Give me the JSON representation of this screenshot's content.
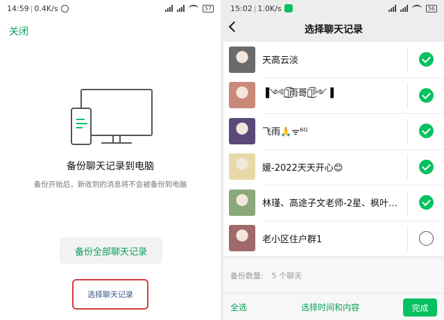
{
  "left": {
    "status": {
      "time": "14:59",
      "speed": "0.4K/s",
      "battery": "57"
    },
    "close_label": "关闭",
    "title": "备份聊天记录到电脑",
    "subtitle": "备份开始后，新收到的消息将不会被备份到电脑",
    "backup_all_label": "备份全部聊天记录",
    "select_label": "选择聊天记录"
  },
  "right": {
    "status": {
      "time": "15:02",
      "speed": "1.0K/s",
      "battery": "56"
    },
    "title": "选择聊天记录",
    "chats": [
      {
        "name": "天高云淡",
        "checked": true,
        "avatar": "#6b6b6b"
      },
      {
        "name": "▐༺ৡ͜͡雨哥ৡ͜͡༻▐",
        "checked": true,
        "avatar": "#c98a7a"
      },
      {
        "name": "飞雨🙏ᯤ⁶ᴳ",
        "checked": true,
        "avatar": "#5a4a7a"
      },
      {
        "name": "媛-2022天天开心😊",
        "checked": true,
        "avatar": "#e8d9a8"
      },
      {
        "name": "林瑾、高途子文老师-2星、枫叶…",
        "checked": true,
        "avatar": "#8aa87a"
      },
      {
        "name": "老小区住户群1",
        "checked": false,
        "avatar": "#a06a6a"
      }
    ],
    "count_label": "备份数量:",
    "count_value": "5 个聊天",
    "select_all_label": "全选",
    "select_time_label": "选择时间和内容",
    "done_label": "完成"
  },
  "colors": {
    "accent": "#07c160",
    "link": "#07a05a",
    "highlight_border": "#d33b3b"
  }
}
